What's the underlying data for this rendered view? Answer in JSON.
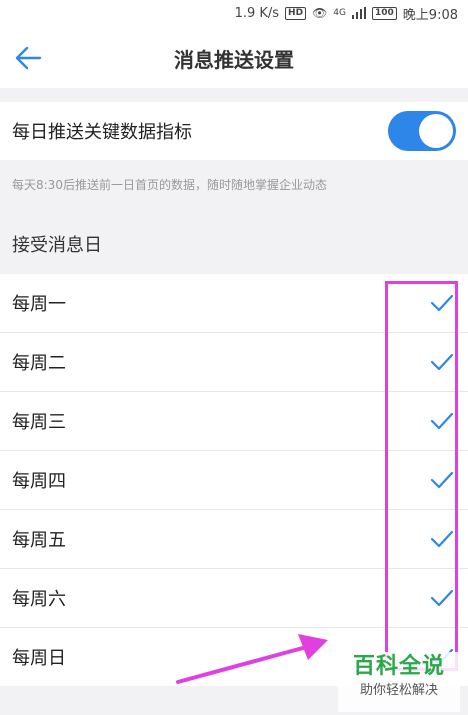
{
  "statusbar": {
    "speed": "1.9 K/s",
    "hd_badge": "HD",
    "network": "4G",
    "battery": "100",
    "time": "晚上9:08"
  },
  "navbar": {
    "title": "消息推送设置"
  },
  "push_setting": {
    "label": "每日推送关键数据指标",
    "enabled": true,
    "description": "每天8:30后推送前一日首页的数据，随时随地掌握企业动态"
  },
  "receive_days": {
    "heading": "接受消息日",
    "days": [
      {
        "label": "每周一",
        "checked": true
      },
      {
        "label": "每周二",
        "checked": true
      },
      {
        "label": "每周三",
        "checked": true
      },
      {
        "label": "每周四",
        "checked": true
      },
      {
        "label": "每周五",
        "checked": true
      },
      {
        "label": "每周六",
        "checked": true
      },
      {
        "label": "每周日",
        "checked": true
      }
    ]
  },
  "accent_color": "#2e86e8",
  "watermark": {
    "title": "百科全说",
    "subtitle": "助你轻松解决"
  }
}
